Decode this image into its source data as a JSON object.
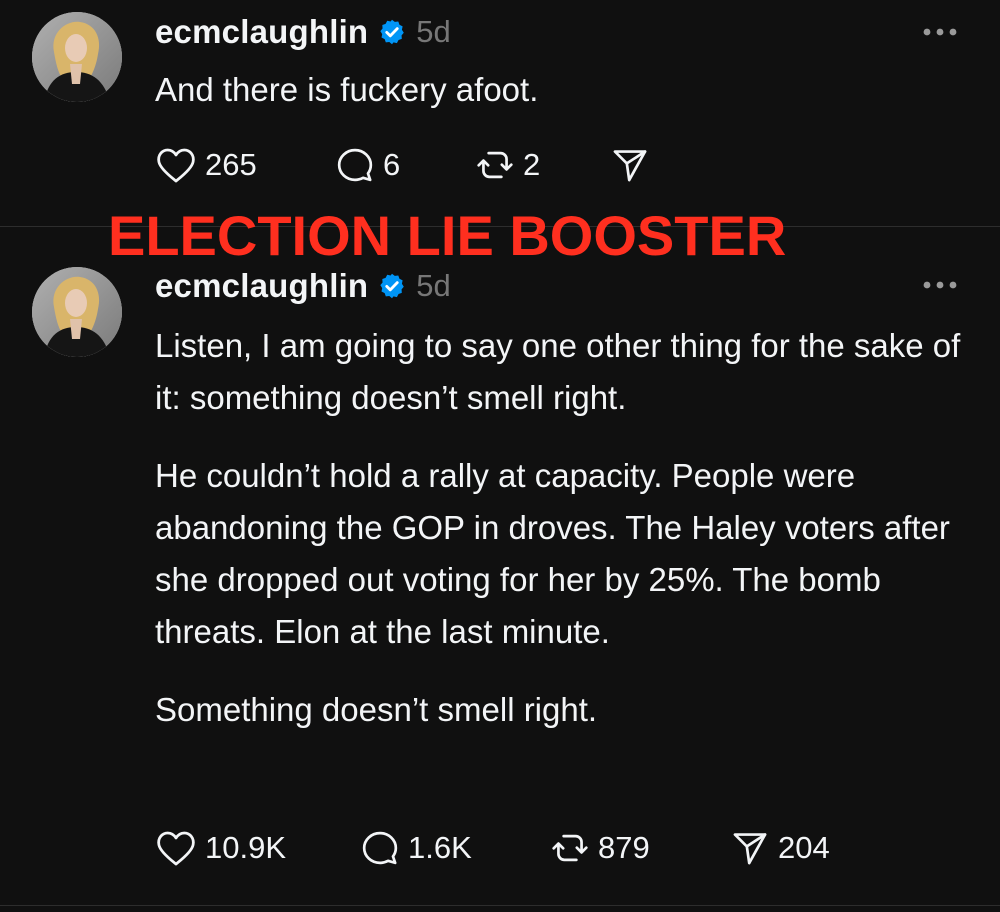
{
  "theme": {
    "background": "#101010",
    "text": "#f3f5f7",
    "muted": "#777777",
    "verified_blue": "#0095f6",
    "caption_red": "#ff2f1f"
  },
  "overlay": {
    "caption": "ELECTION LIE BOOSTER"
  },
  "posts": [
    {
      "username": "ecmclaughlin",
      "verified": true,
      "time": "5d",
      "paragraphs": [
        "And there is fuckery afoot."
      ],
      "likes": "265",
      "replies": "6",
      "reposts": "2",
      "shares": ""
    },
    {
      "username": "ecmclaughlin",
      "verified": true,
      "time": "5d",
      "paragraphs": [
        "Listen, I am going to say one other thing for the sake of it: something doesn’t smell right.",
        "He couldn’t hold a rally at capacity. People were abandoning the GOP in droves. The Haley voters after she dropped out voting for her by 25%. The bomb threats. Elon at the last minute.",
        "Something doesn’t smell right."
      ],
      "likes": "10.9K",
      "replies": "1.6K",
      "reposts": "879",
      "shares": "204"
    }
  ],
  "icons": {
    "avatar": "profile-photo",
    "verified": "verified-badge-icon",
    "more": "more-horizontal-icon",
    "like": "heart-icon",
    "reply": "comment-bubble-icon",
    "repost": "repost-arrows-icon",
    "share": "send-plane-icon"
  }
}
